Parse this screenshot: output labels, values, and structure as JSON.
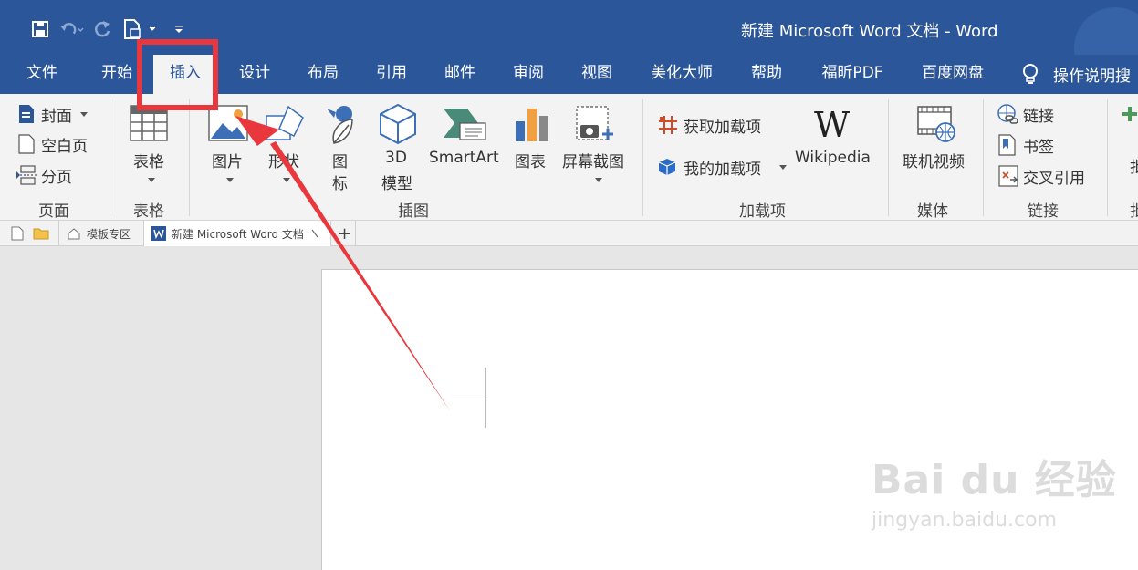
{
  "title_bar": {
    "doc_title": "新建 Microsoft Word 文档  -  Word"
  },
  "tabs": [
    {
      "label": "文件"
    },
    {
      "label": "开始"
    },
    {
      "label": "插入"
    },
    {
      "label": "设计"
    },
    {
      "label": "布局"
    },
    {
      "label": "引用"
    },
    {
      "label": "邮件"
    },
    {
      "label": "审阅"
    },
    {
      "label": "视图"
    },
    {
      "label": "美化大师"
    },
    {
      "label": "帮助"
    },
    {
      "label": "福昕PDF"
    },
    {
      "label": "百度网盘"
    }
  ],
  "active_tab": "插入",
  "tell_me": "操作说明搜",
  "ribbon": {
    "pages": {
      "cover": "封面",
      "blank": "空白页",
      "break": "分页",
      "group": "页面"
    },
    "tables": {
      "table": "表格",
      "group": "表格"
    },
    "illustrations": {
      "picture": "图片",
      "shapes": "形状",
      "icons_1": "图",
      "icons_2": "标",
      "model_1": "3D",
      "model_2": "模型",
      "smartart": "SmartArt",
      "chart": "图表",
      "screenshot": "屏幕截图",
      "group": "插图"
    },
    "addins": {
      "get": "获取加载项",
      "my": "我的加载项",
      "wikipedia": "Wikipedia",
      "wiki_logo": "W",
      "group": "加载项"
    },
    "media": {
      "online_video": "联机视频",
      "group": "媒体"
    },
    "links": {
      "link": "链接",
      "bookmark": "书签",
      "crossref": "交叉引用",
      "group": "链接"
    },
    "overflow_1": "批",
    "overflow_2": "批"
  },
  "doc_tabs": {
    "templates": "模板专区",
    "document": "新建 Microsoft Word 文档",
    "add": "+"
  },
  "watermark": {
    "main": "Bai du 经验",
    "sub": "jingyan.baidu.com"
  },
  "colors": {
    "brand": "#2b579a",
    "highlight": "#e8383d"
  }
}
